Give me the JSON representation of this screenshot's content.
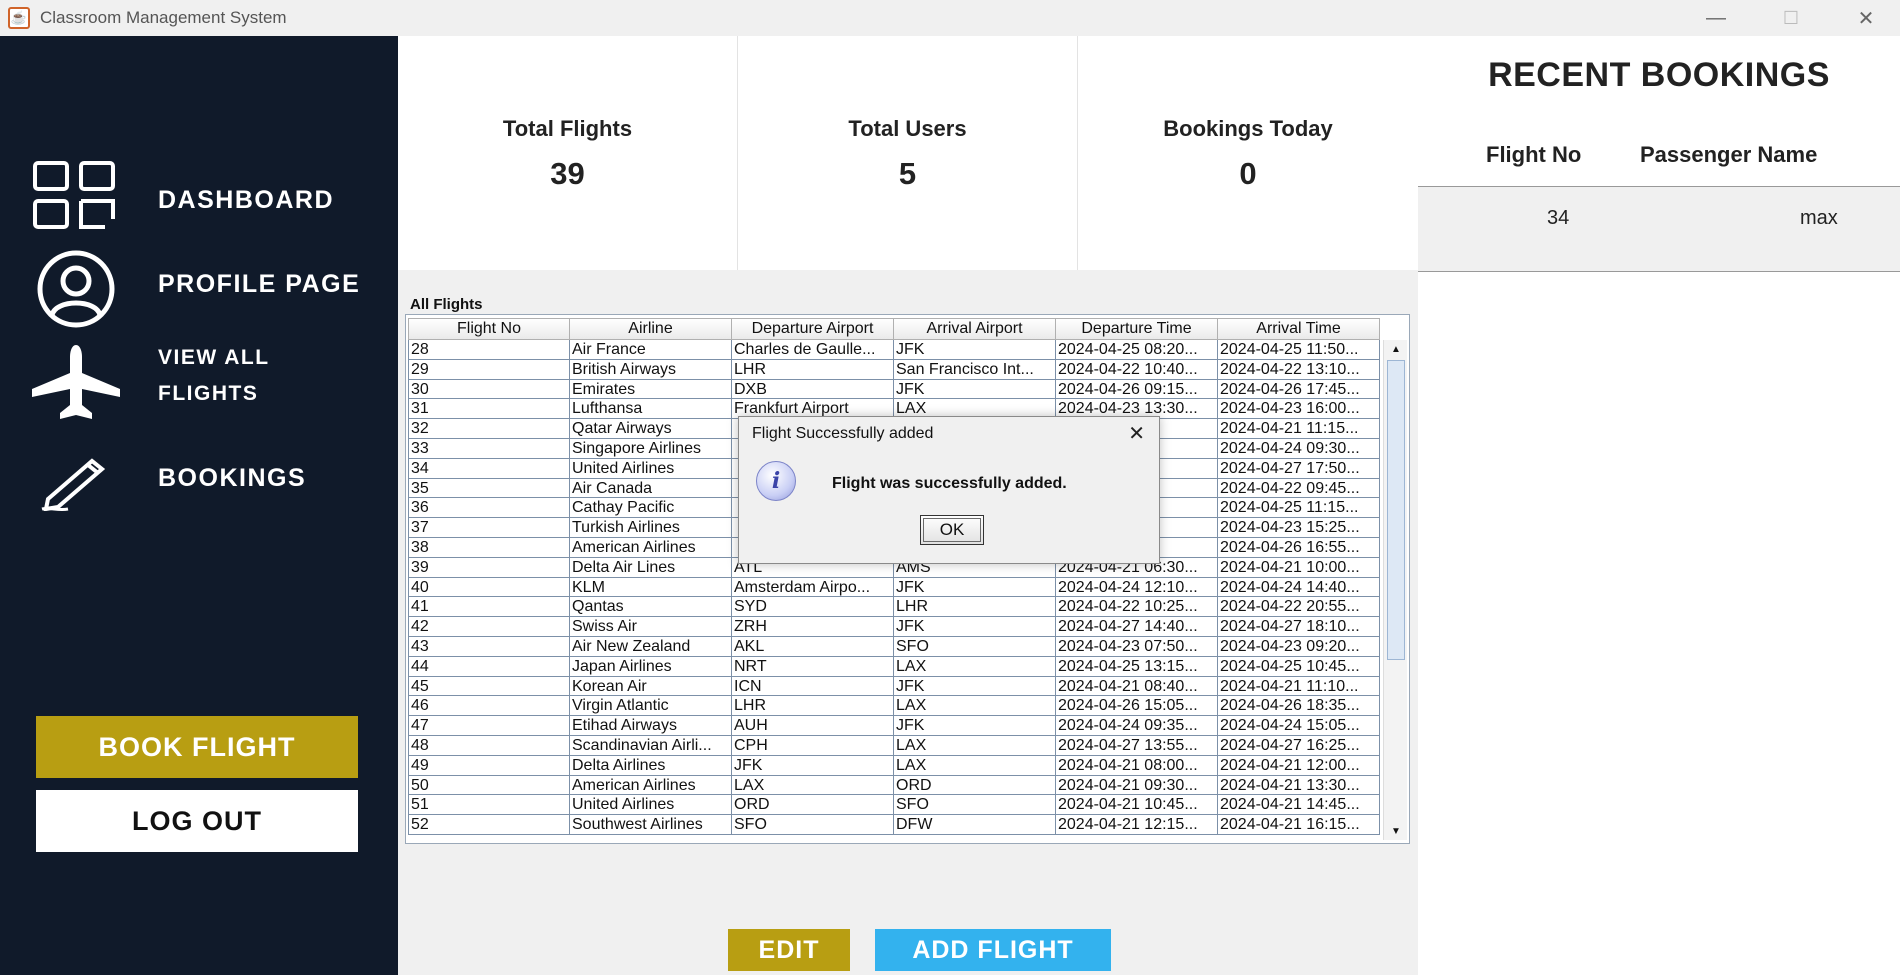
{
  "window": {
    "title": "Classroom Management System",
    "minimize": "—",
    "maximize": "☐",
    "close": "✕"
  },
  "sidebar": {
    "items": [
      {
        "label": "DASHBOARD",
        "icon": "grid-icon"
      },
      {
        "label": "PROFILE PAGE",
        "icon": "user-icon"
      },
      {
        "label": "VIEW ALL",
        "icon": "airplane-icon"
      },
      {
        "label": "FLIGHTS",
        "icon": ""
      },
      {
        "label": "BOOKINGS",
        "icon": "pencil-icon"
      }
    ],
    "book_flight": "BOOK FLIGHT",
    "log_out": "LOG OUT"
  },
  "stats": [
    {
      "label": "Total Flights",
      "value": "39"
    },
    {
      "label": "Total Users",
      "value": "5"
    },
    {
      "label": "Bookings Today",
      "value": "0"
    }
  ],
  "recent": {
    "heading": "RECENT BOOKINGS",
    "columns": [
      "Flight No",
      "Passenger Name"
    ],
    "rows": [
      {
        "flight_no": "34",
        "passenger": "max"
      }
    ]
  },
  "flights_panel": {
    "title": "All Flights",
    "columns": [
      "Flight No",
      "Airline",
      "Departure Airport",
      "Arrival Airport",
      "Departure Time",
      "Arrival Time"
    ],
    "rows": [
      [
        "28",
        "Air France",
        "Charles de Gaulle...",
        "JFK",
        "2024-04-25 08:20...",
        "2024-04-25 11:50..."
      ],
      [
        "29",
        "British Airways",
        "LHR",
        "San Francisco Int...",
        "2024-04-22 10:40...",
        "2024-04-22 13:10..."
      ],
      [
        "30",
        "Emirates",
        "DXB",
        "JFK",
        "2024-04-26 09:15...",
        "2024-04-26 17:45..."
      ],
      [
        "31",
        "Lufthansa",
        "Frankfurt Airport",
        "LAX",
        "2024-04-23 13:30...",
        "2024-04-23 16:00..."
      ],
      [
        "32",
        "Qatar Airways",
        "",
        "",
        "06:45...",
        "2024-04-21 11:15..."
      ],
      [
        "33",
        "Singapore Airlines",
        "",
        "",
        "11:00...",
        "2024-04-24 09:30..."
      ],
      [
        "34",
        "United Airlines",
        "",
        "",
        "14:20...",
        "2024-04-27 17:50..."
      ],
      [
        "35",
        "Air Canada",
        "",
        "",
        "07:15...",
        "2024-04-22 09:45..."
      ],
      [
        "36",
        "Cathay Pacific",
        "",
        "",
        "12:45...",
        "2024-04-25 11:15..."
      ],
      [
        "37",
        "Turkish Airlines",
        "",
        "",
        "10:55...",
        "2024-04-23 15:25..."
      ],
      [
        "38",
        "American Airlines",
        "",
        "",
        "13:25...",
        "2024-04-26 16:55..."
      ],
      [
        "39",
        "Delta Air Lines",
        "ATL",
        "AMS",
        "2024-04-21 06:30...",
        "2024-04-21 10:00..."
      ],
      [
        "40",
        "KLM",
        "Amsterdam Airpo...",
        "JFK",
        "2024-04-24 12:10...",
        "2024-04-24 14:40..."
      ],
      [
        "41",
        "Qantas",
        "SYD",
        "LHR",
        "2024-04-22 10:25...",
        "2024-04-22 20:55..."
      ],
      [
        "42",
        "Swiss Air",
        "ZRH",
        "JFK",
        "2024-04-27 14:40...",
        "2024-04-27 18:10..."
      ],
      [
        "43",
        "Air New Zealand",
        "AKL",
        "SFO",
        "2024-04-23 07:50...",
        "2024-04-23 09:20..."
      ],
      [
        "44",
        "Japan Airlines",
        "NRT",
        "LAX",
        "2024-04-25 13:15...",
        "2024-04-25 10:45..."
      ],
      [
        "45",
        "Korean Air",
        "ICN",
        "JFK",
        "2024-04-21 08:40...",
        "2024-04-21 11:10..."
      ],
      [
        "46",
        "Virgin Atlantic",
        "LHR",
        "LAX",
        "2024-04-26 15:05...",
        "2024-04-26 18:35..."
      ],
      [
        "47",
        "Etihad Airways",
        "AUH",
        "JFK",
        "2024-04-24 09:35...",
        "2024-04-24 15:05..."
      ],
      [
        "48",
        "Scandinavian Airli...",
        "CPH",
        "LAX",
        "2024-04-27 13:55...",
        "2024-04-27 16:25..."
      ],
      [
        "49",
        "Delta Airlines",
        "JFK",
        "LAX",
        "2024-04-21 08:00...",
        "2024-04-21 12:00..."
      ],
      [
        "50",
        "American Airlines",
        "LAX",
        "ORD",
        "2024-04-21 09:30...",
        "2024-04-21 13:30..."
      ],
      [
        "51",
        "United Airlines",
        "ORD",
        "SFO",
        "2024-04-21 10:45...",
        "2024-04-21 14:45..."
      ],
      [
        "52",
        "Southwest Airlines",
        "SFO",
        "DFW",
        "2024-04-21 12:15...",
        "2024-04-21 16:15..."
      ]
    ],
    "edit": "EDIT",
    "add_flight": "ADD FLIGHT"
  },
  "dialog": {
    "title": "Flight Successfully added",
    "message": "Flight was successfully added.",
    "ok": "OK",
    "close": "✕",
    "icon": "info-icon"
  },
  "colors": {
    "sidebar": "#101a2a",
    "gold": "#b89e12",
    "blue": "#33b2ee"
  }
}
